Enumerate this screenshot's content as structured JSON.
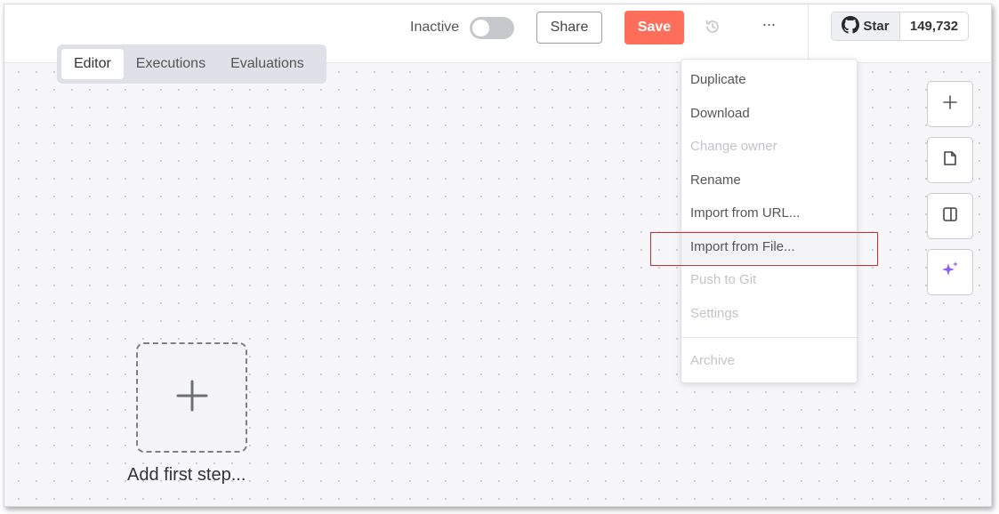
{
  "header": {
    "status_label": "Inactive",
    "share_label": "Share",
    "save_label": "Save",
    "more_label": "···",
    "github": {
      "star_label": "Star",
      "star_count": "149,732"
    }
  },
  "tabs": [
    {
      "label": "Editor",
      "active": true
    },
    {
      "label": "Executions",
      "active": false
    },
    {
      "label": "Evaluations",
      "active": false
    }
  ],
  "menu": {
    "items": [
      {
        "label": "Duplicate",
        "disabled": false
      },
      {
        "label": "Download",
        "disabled": false
      },
      {
        "label": "Change owner",
        "disabled": true
      },
      {
        "label": "Rename",
        "disabled": false
      },
      {
        "label": "Import from URL...",
        "disabled": false
      },
      {
        "label": "Import from File...",
        "disabled": false,
        "hovered": true
      },
      {
        "label": "Push to Git",
        "disabled": true
      },
      {
        "label": "Settings",
        "disabled": true
      },
      {
        "label": "Archive",
        "disabled": true
      }
    ]
  },
  "tools": [
    "plus-icon",
    "sticky-note-icon",
    "side-panel-icon",
    "ai-sparkle-icon"
  ],
  "canvas": {
    "add_step_label": "Add first step..."
  },
  "colors": {
    "save": "#ff6e5a",
    "highlight": "#d62b2b",
    "ai_accent": "#8b5cf6",
    "tab_bar": "#dfe0e8"
  }
}
